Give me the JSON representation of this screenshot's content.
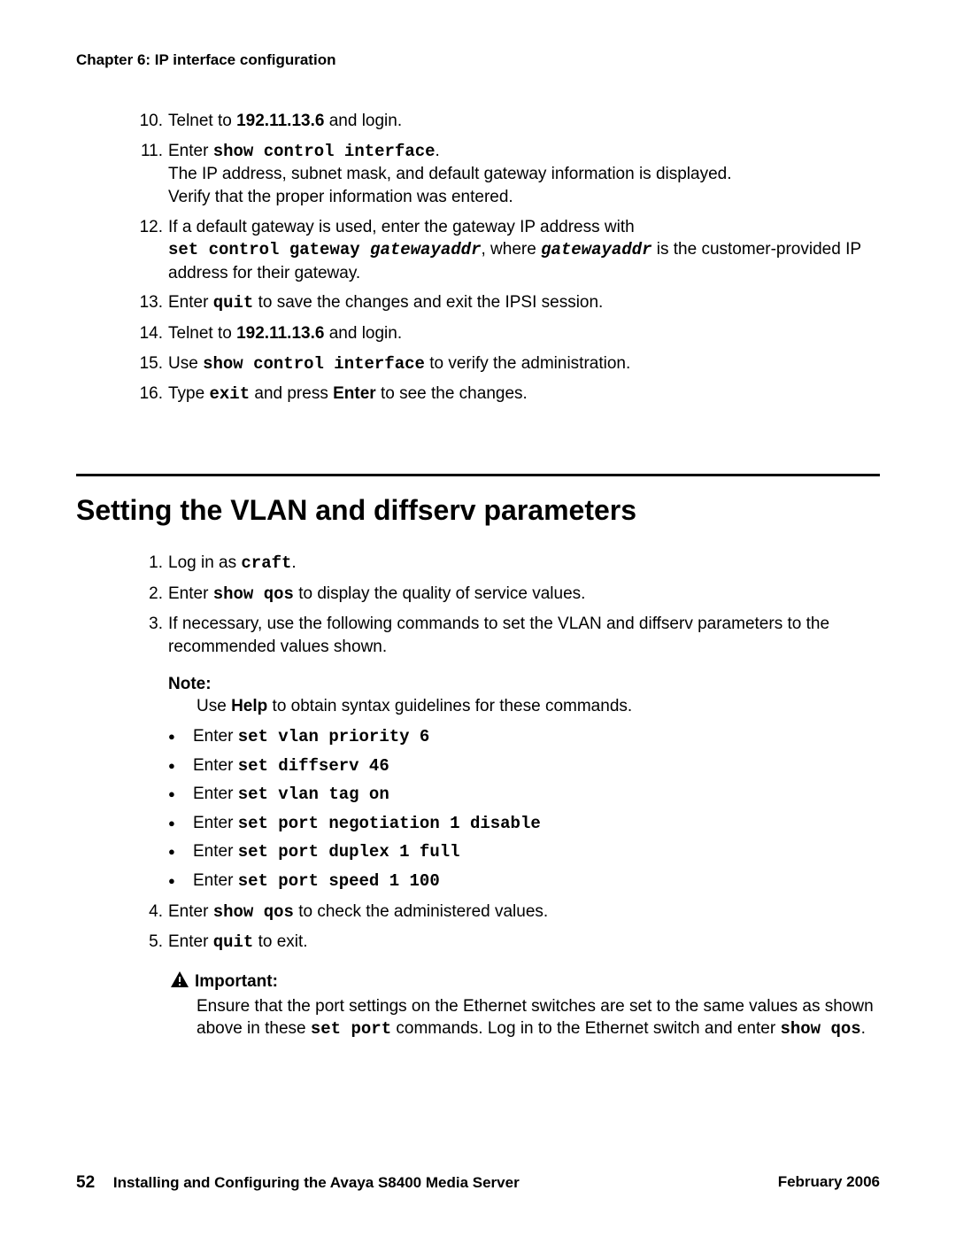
{
  "chapter": "Chapter 6: IP interface configuration",
  "steps_a": {
    "10": {
      "pre": "Telnet to ",
      "ip": "192.11.13.6",
      "post": " and login."
    },
    "11": {
      "a": "Enter ",
      "cmd": "show control interface",
      "a2": ".",
      "l2": "The IP address, subnet mask, and default gateway information is displayed.",
      "l3": "Verify that the proper information was entered."
    },
    "12": {
      "a": "If a default gateway is used, enter the gateway IP address with",
      "cmd": "set control gateway ",
      "var": "gatewayaddr",
      "mid": ", where ",
      "var2": "gatewayaddr",
      "tail": " is the customer-provided IP address for their gateway."
    },
    "13": {
      "a": "Enter ",
      "cmd": "quit",
      "b": " to save the changes and exit the IPSI session."
    },
    "14": {
      "a": "Telnet to ",
      "ip": "192.11.13.6",
      "b": " and login."
    },
    "15": {
      "a": "Use ",
      "cmd": "show control interface",
      "b": " to verify the administration."
    },
    "16": {
      "a": "Type ",
      "cmd": "exit",
      "b": " and press ",
      "key": "Enter",
      "c": " to see the changes."
    }
  },
  "section_title": "Setting the VLAN and diffserv parameters",
  "steps_b": {
    "1": {
      "a": "Log in as ",
      "cmd": "craft",
      "b": "."
    },
    "2": {
      "a": "Enter ",
      "cmd": "show qos",
      "b": " to display the quality of service values."
    },
    "3": {
      "a": "If necessary, use the following commands to set the VLAN and diffserv parameters to the recommended values shown."
    },
    "4": {
      "a": "Enter ",
      "cmd": "show qos",
      "b": " to check the administered values."
    },
    "5": {
      "a": "Enter ",
      "cmd": "quit",
      "b": " to exit."
    }
  },
  "note": {
    "label": "Note:",
    "text_a": "Use ",
    "help": "Help",
    "text_b": " to obtain syntax guidelines for these commands."
  },
  "bullets": [
    {
      "a": "Enter ",
      "cmd": "set vlan priority 6"
    },
    {
      "a": "Enter ",
      "cmd": "set diffserv 46"
    },
    {
      "a": "Enter ",
      "cmd": "set vlan tag on"
    },
    {
      "a": "Enter ",
      "cmd": "set port negotiation 1 disable"
    },
    {
      "a": "Enter ",
      "cmd": "set port duplex 1 full"
    },
    {
      "a": "Enter ",
      "cmd": "set port speed 1 100"
    }
  ],
  "important": {
    "label": "Important:",
    "text_a": "Ensure that the port settings on the Ethernet switches are set to the same values as shown above in these ",
    "cmd1": "set port",
    "text_b": " commands. Log in to the Ethernet switch and enter ",
    "cmd2": "show qos",
    "text_c": "."
  },
  "footer": {
    "page": "52",
    "title": "Installing and Configuring the Avaya S8400 Media Server",
    "date": "February 2006"
  }
}
